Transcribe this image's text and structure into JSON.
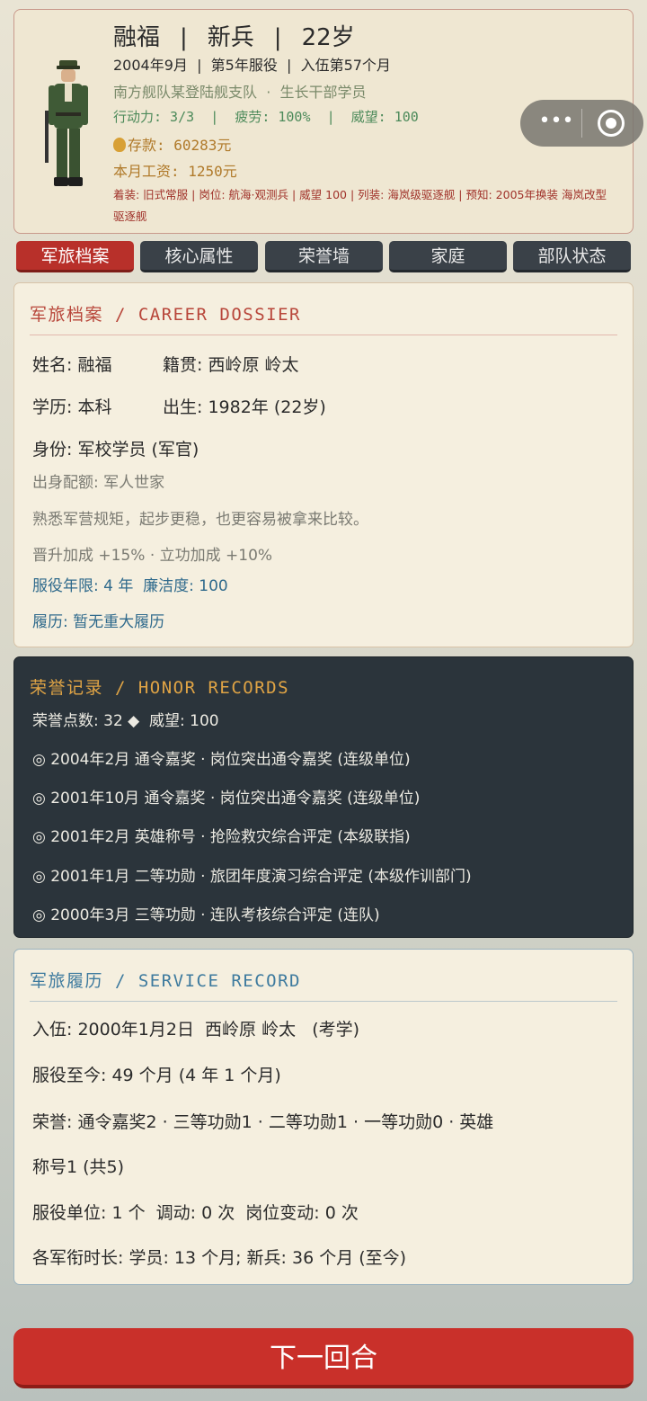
{
  "header": {
    "name": "融福",
    "rank": "新兵",
    "age": "22岁",
    "sep": "|",
    "date": "2004年9月",
    "service_year": "第5年服役",
    "enlist_month": "入伍第57个月",
    "unit": "南方舰队某登陆舰支队",
    "unit_sep": "·",
    "role": "生长干部学员",
    "action": "行动力: 3/3",
    "fatigue": "疲劳: 100%",
    "prestige": "威望: 100",
    "pipe": "|",
    "savings_icon": "money-bag-icon",
    "savings": "存款: 60283元",
    "salary": "本月工资: 1250元",
    "detail": "着装: 旧式常服 | 岗位: 航海·观测兵 | 威望 100 | 列装: 海岚级驱逐舰 | 预知: 2005年换装 海岚改型驱逐舰"
  },
  "capsule": {
    "more": "•••"
  },
  "tabs": [
    {
      "label": "军旅档案",
      "active": true
    },
    {
      "label": "核心属性",
      "active": false
    },
    {
      "label": "荣誉墙",
      "active": false
    },
    {
      "label": "家庭",
      "active": false
    },
    {
      "label": "部队状态",
      "active": false
    }
  ],
  "dossier": {
    "title": "军旅档案 / CAREER DOSSIER",
    "name": "姓名: 融福",
    "origin": "籍贯: 西岭原 岭太",
    "education": "学历: 本科",
    "birth": "出生: 1982年 (22岁)",
    "identity": "身份: 军校学员 (军官)",
    "quota": "出身配额: 军人世家",
    "desc": "熟悉军营规矩，起步更稳，也更容易被拿来比较。",
    "bonus": "晋升加成 +15% · 立功加成 +10%",
    "term": "服役年限: 4 年  廉洁度: 100",
    "history": "履历: 暂无重大履历"
  },
  "honor": {
    "title": "荣誉记录 / HONOR RECORDS",
    "summary": "荣誉点数: 32 ◆  威望: 100",
    "records": [
      "◎ 2004年2月 通令嘉奖 · 岗位突出通令嘉奖 (连级单位)",
      "◎ 2001年10月 通令嘉奖 · 岗位突出通令嘉奖 (连级单位)",
      "◎ 2001年2月 英雄称号 · 抢险救灾综合评定 (本级联指)",
      "◎ 2001年1月 二等功勋 · 旅团年度演习综合评定 (本级作训部门)",
      "◎ 2000年3月 三等功勋 · 连队考核综合评定 (连队)"
    ]
  },
  "record": {
    "title": "军旅履历 / SERVICE RECORD",
    "enlist": "入伍: 2000年1月2日  西岭原 岭太   (考学)",
    "duration": "服役至今: 49 个月 (4 年 1 个月)",
    "honors_line1": "荣誉: 通令嘉奖2 · 三等功勋1 · 二等功勋1 · 一等功勋0 · 英雄",
    "honors_line2": "称号1 (共5)",
    "units": "服役单位: 1 个  调动: 0 次  岗位变动: 0 次",
    "ranks": "各军衔时长: 学员: 13 个月; 新兵: 36 个月 (至今)"
  },
  "next_button": "下一回合"
}
